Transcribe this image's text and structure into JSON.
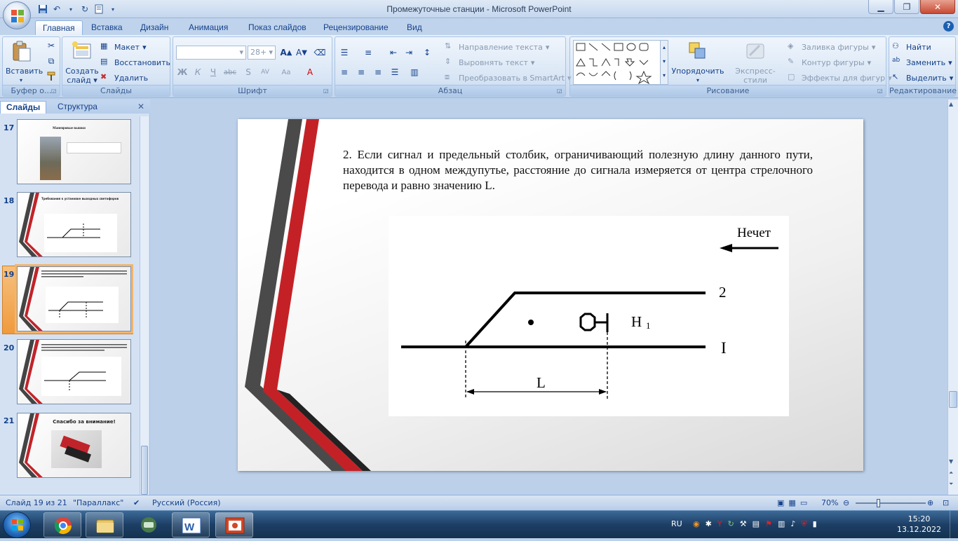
{
  "window": {
    "title": "Промежуточные станции - Microsoft PowerPoint"
  },
  "tabs": [
    {
      "label": "Главная"
    },
    {
      "label": "Вставка"
    },
    {
      "label": "Дизайн"
    },
    {
      "label": "Анимация"
    },
    {
      "label": "Показ слайдов"
    },
    {
      "label": "Рецензирование"
    },
    {
      "label": "Вид"
    }
  ],
  "ribbon": {
    "clipboard": {
      "paste": "Вставить",
      "label": "Буфер о..."
    },
    "slides": {
      "new_slide_line1": "Создать",
      "new_slide_line2": "слайд",
      "layout": "Макет",
      "reset": "Восстановить",
      "delete": "Удалить",
      "label": "Слайды"
    },
    "font": {
      "size": "28+",
      "label": "Шрифт"
    },
    "paragraph": {
      "text_direction": "Направление текста",
      "align_text": "Выровнять текст",
      "smartart": "Преобразовать в SmartArt",
      "label": "Абзац"
    },
    "drawing": {
      "arrange": "Упорядочить",
      "quick_styles": "Экспресс-стили",
      "fill": "Заливка фигуры",
      "outline": "Контур фигуры",
      "effects": "Эффекты для фигур",
      "label": "Рисование"
    },
    "editing": {
      "find": "Найти",
      "replace": "Заменить",
      "select": "Выделить",
      "label": "Редактирование"
    }
  },
  "panel": {
    "tab_slides": "Слайды",
    "tab_outline": "Структура",
    "thumbnails": [
      {
        "number": "17",
        "title": "Маневровые вышки"
      },
      {
        "number": "18",
        "title": "Требования к установке выходных светофоров"
      },
      {
        "number": "19",
        "title": ""
      },
      {
        "number": "20",
        "title": ""
      },
      {
        "number": "21",
        "title": "Спасибо за внимание!"
      }
    ]
  },
  "slide": {
    "text": "2. Если сигнал и предельный столбик, ограничивающий полезную длину данного пути, находится в одном междупутье, расстояние до сигнала измеряется от центра стрелочного перевода и равно значению L.",
    "diagram": {
      "direction_label": "Нечет",
      "track_2": "2",
      "track_1": "I",
      "signal_label": "Н",
      "signal_sub": "1",
      "distance_label": "L"
    }
  },
  "statusbar": {
    "slide_counter": "Слайд 19 из 21",
    "theme": "\"Параллакс\"",
    "language": "Русский (Россия)",
    "zoom": "70%"
  },
  "taskbar": {
    "lang": "RU",
    "time": "15:20",
    "date": "13.12.2022"
  }
}
